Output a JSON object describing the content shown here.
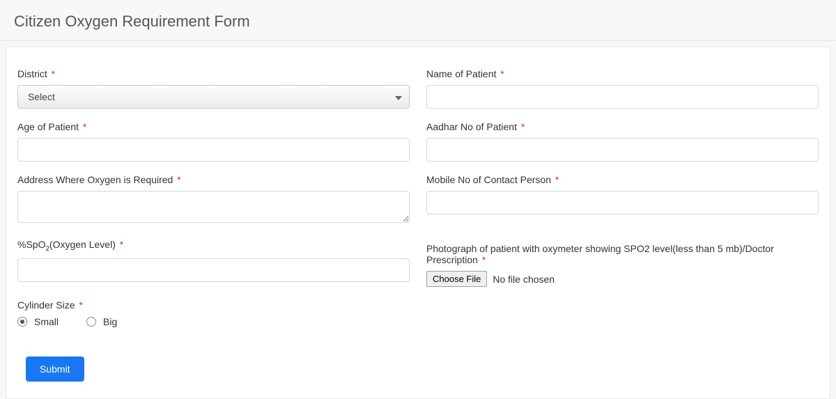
{
  "header": {
    "title": "Citizen Oxygen Requirement Form"
  },
  "form": {
    "district": {
      "label": "District",
      "required": true,
      "selected": "Select"
    },
    "patient_name": {
      "label": "Name of Patient",
      "required": true,
      "value": ""
    },
    "patient_age": {
      "label": "Age of Patient",
      "required": true,
      "value": ""
    },
    "aadhar": {
      "label": "Aadhar No of Patient",
      "required": true,
      "value": ""
    },
    "address": {
      "label": "Address Where Oxygen is Required",
      "required": true,
      "value": ""
    },
    "mobile": {
      "label": "Mobile No of Contact Person",
      "required": true,
      "value": ""
    },
    "spo2": {
      "label_pre": "%SpO",
      "label_sub": "2",
      "label_post": "(Oxygen Level)",
      "required": true,
      "value": ""
    },
    "photo": {
      "caption": "Photograph of patient with oxymeter showing SPO2 level(less than 5 mb)/Doctor Prescription",
      "required": true,
      "button": "Choose File",
      "status": "No file chosen"
    },
    "cylinder": {
      "label": "Cylinder Size",
      "required": true,
      "options": {
        "small": "Small",
        "big": "Big"
      },
      "selected": "small"
    },
    "submit": "Submit"
  },
  "required_marker": "*"
}
